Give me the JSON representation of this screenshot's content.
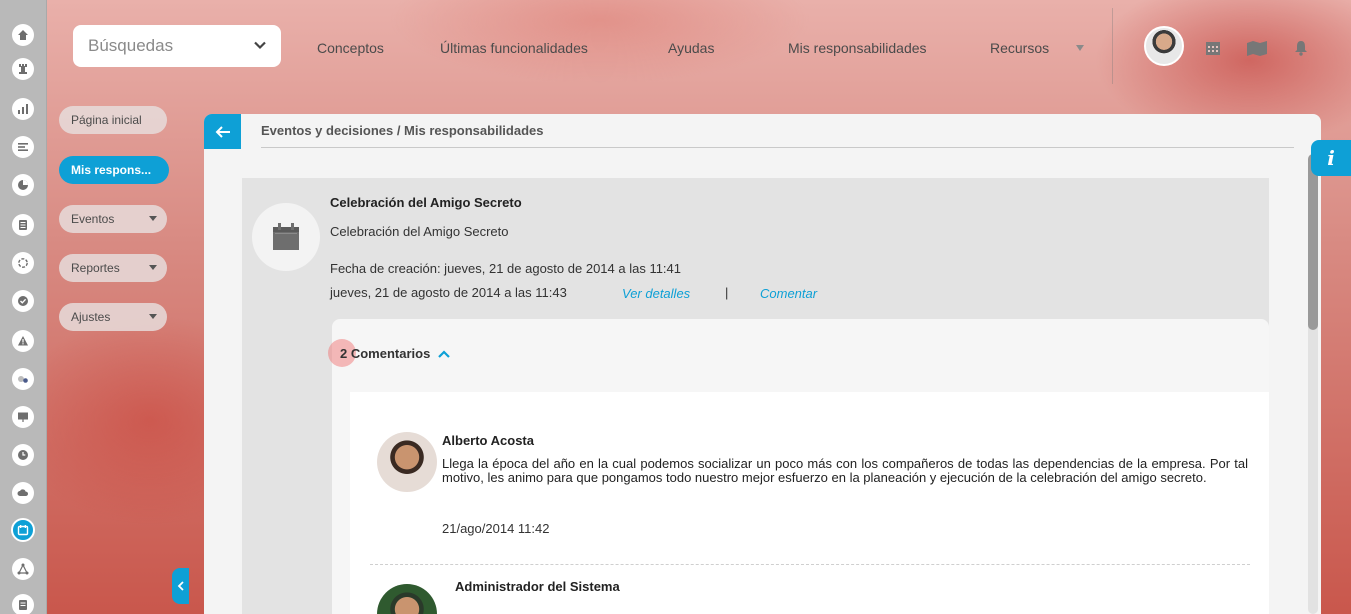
{
  "topbar": {
    "search_placeholder": "Búsquedas",
    "nav": [
      "Conceptos",
      "Últimas funcionalidades",
      "Ayudas",
      "Mis responsabilidades",
      "Recursos"
    ]
  },
  "subsidebar": {
    "home": "Página inicial",
    "active": "Mis respons...",
    "events": "Eventos",
    "reports": "Reportes",
    "settings": "Ajustes"
  },
  "panel": {
    "breadcrumb": "Eventos y decisiones / Mis responsabilidades"
  },
  "event": {
    "title": "Celebración del Amigo Secreto",
    "description": "Celebración del Amigo Secreto",
    "created": "Fecha de creación: jueves, 21 de agosto de 2014 a las 11:41",
    "date": "jueves, 21 de agosto de 2014 a las 11:43",
    "details_link": "Ver detalles",
    "separator": "|",
    "comment_link": "Comentar"
  },
  "comments": {
    "toggle_label": "2 Comentarios",
    "items": [
      {
        "author": "Alberto Acosta",
        "text": "Llega la época del año en la cual podemos socializar un poco más con los compañeros de todas las dependencias de la empresa. Por tal motivo, les animo para que pongamos todo nuestro mejor esfuerzo en la planeación y ejecución de la celebración del amigo secreto.",
        "date": "21/ago/2014 11:42"
      },
      {
        "author": "Administrador del Sistema"
      }
    ]
  },
  "info_label": "i",
  "colors": {
    "accent": "#0ea0d6",
    "rail": "#b9b9b9"
  }
}
